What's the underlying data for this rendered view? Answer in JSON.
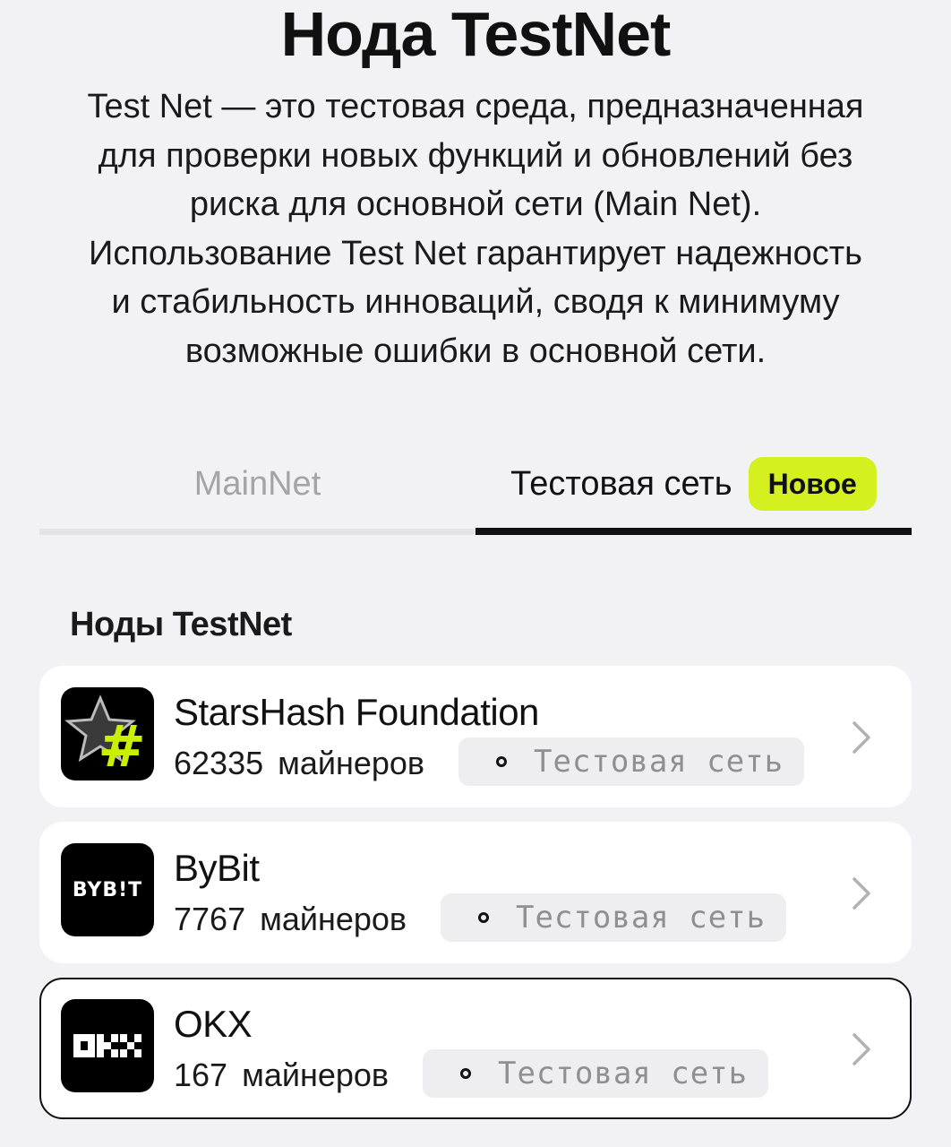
{
  "header": {
    "title": "Нода TestNet",
    "description_lines": [
      "Test Net — это тестовая среда, предназначенная",
      "для проверки новых функций и обновлений без",
      "риска для основной сети (Main Net).",
      "Использование Test Net гарантирует надежность",
      "и стабильность инноваций, сводя к минимуму",
      "возможные ошибки в основной сети."
    ]
  },
  "tabs": {
    "mainnet_label": "MainNet",
    "testnet_label": "Тестовая сеть",
    "new_badge": "Новое",
    "active": "testnet"
  },
  "section": {
    "title": "Ноды TestNet"
  },
  "nodes": [
    {
      "name": "StarsHash Foundation",
      "miners_count": "62335",
      "miners_label": "майнеров",
      "network_badge": "Тестовая сеть",
      "logo_icon": "starshash-logo",
      "selected": false
    },
    {
      "name": "ByBit",
      "miners_count": "7767",
      "miners_label": "майнеров",
      "network_badge": "Тестовая сеть",
      "logo_icon": "bybit-logo",
      "logo_text": "BYB!T",
      "selected": false
    },
    {
      "name": "OKX",
      "miners_count": "167",
      "miners_label": "майнеров",
      "network_badge": "Тестовая сеть",
      "logo_icon": "okx-logo",
      "selected": true
    }
  ],
  "colors": {
    "accent": "#d4f01e",
    "background": "#f2f2f4",
    "card": "#ffffff",
    "text": "#111111",
    "muted": "#a3a3a8"
  }
}
